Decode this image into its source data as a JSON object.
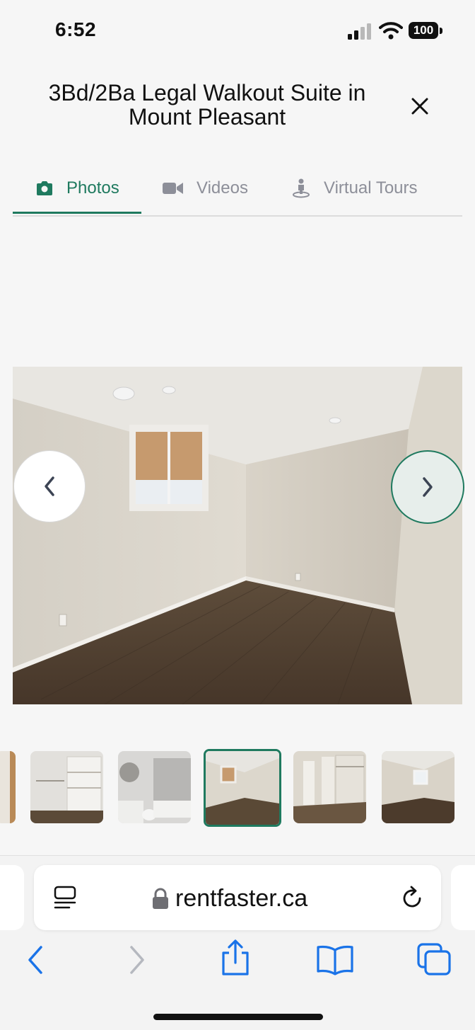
{
  "status_bar": {
    "time": "6:52",
    "battery": "100"
  },
  "header": {
    "title": "3Bd/2Ba Legal Walkout Suite in Mount Pleasant"
  },
  "tabs": [
    {
      "label": "Photos",
      "icon": "camera-icon",
      "active": true
    },
    {
      "label": "Videos",
      "icon": "video-camera-icon",
      "active": false
    },
    {
      "label": "Virtual Tours",
      "icon": "person-pin-icon",
      "active": false
    }
  ],
  "gallery": {
    "active_index": 3,
    "thumbnail_count": 6
  },
  "browser": {
    "url": "rentfaster.ca"
  },
  "colors": {
    "accent": "#1f7a5f",
    "ios_blue": "#1a73e8",
    "muted": "#8d8f99"
  }
}
